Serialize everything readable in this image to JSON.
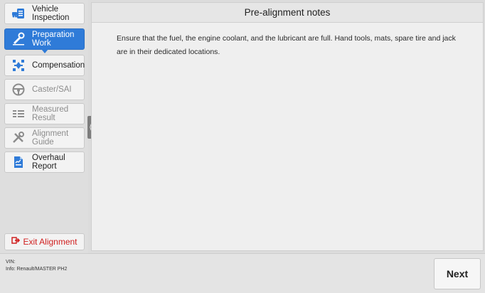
{
  "sidebar": {
    "items": [
      {
        "label_line1": "Vehicle",
        "label_line2": "Inspection",
        "icon": "vehicle-inspection-icon"
      },
      {
        "label_line1": "Preparation",
        "label_line2": "Work",
        "icon": "preparation-wrench-icon"
      },
      {
        "label_line1": "Compensation",
        "label_line2": "",
        "icon": "compensation-icon"
      },
      {
        "label_line1": "Caster/SAI",
        "label_line2": "",
        "icon": "steering-wheel-icon"
      },
      {
        "label_line1": "Measured",
        "label_line2": "Result",
        "icon": "measured-result-icon"
      },
      {
        "label_line1": "Alignment",
        "label_line2": "Guide",
        "icon": "tools-icon"
      },
      {
        "label_line1": "Overhaul Report",
        "label_line2": "",
        "icon": "report-document-icon"
      }
    ],
    "exit_label": "Exit Alignment"
  },
  "main": {
    "title": "Pre-alignment notes",
    "body": "Ensure that the fuel, the engine coolant, and the lubricant are full. Hand tools, mats, spare tire and jack are in their dedicated locations."
  },
  "footer": {
    "vin": "VIN:",
    "info": "Info: Renault/MASTER PH2",
    "next_label": "Next"
  },
  "colors": {
    "accent": "#2f7bd8",
    "exit_red": "#d01f1f"
  }
}
